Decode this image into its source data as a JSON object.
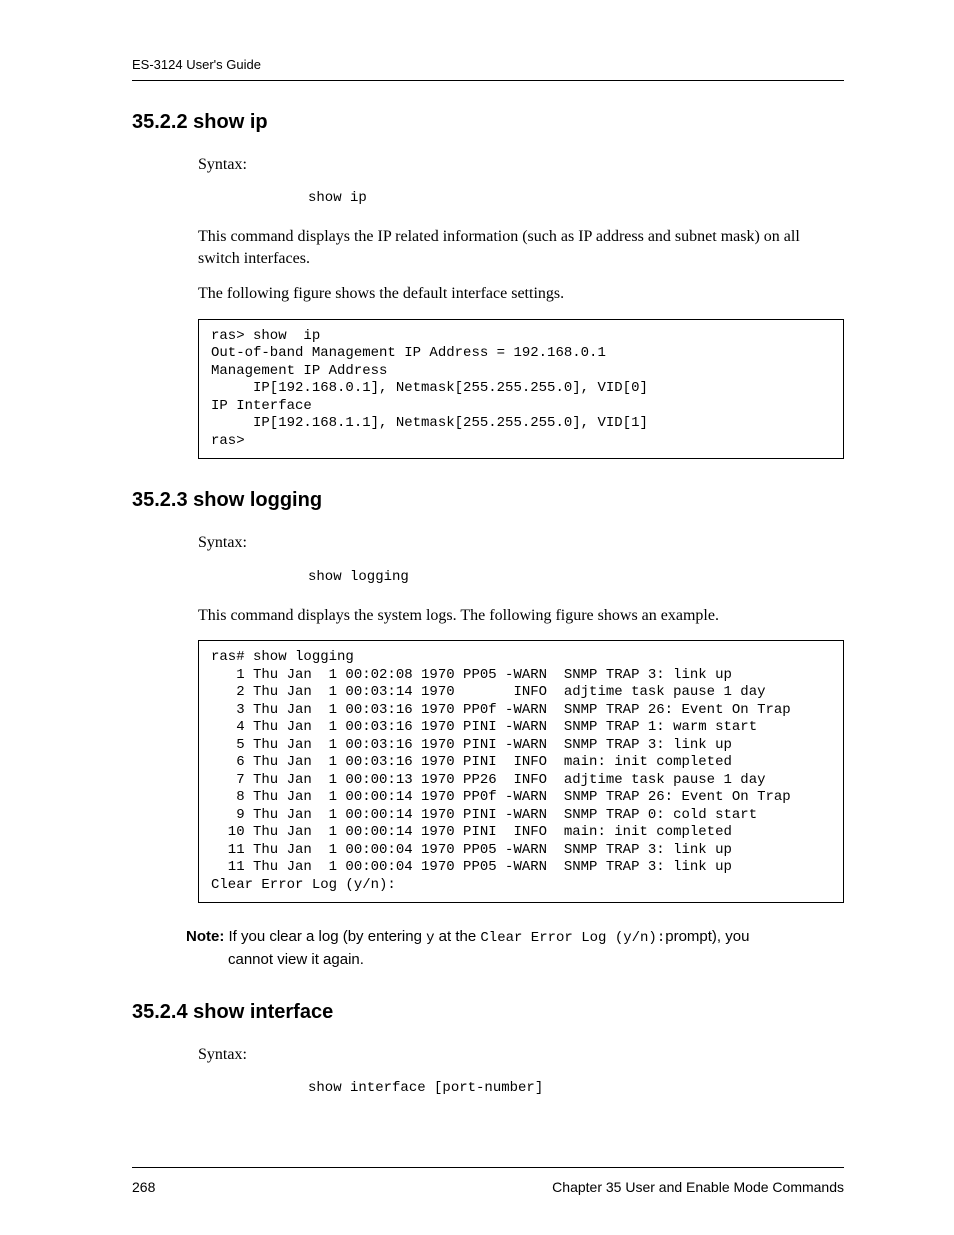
{
  "header": {
    "running_head": "ES-3124 User's Guide"
  },
  "sections": {
    "show_ip": {
      "heading": "35.2.2  show ip",
      "syntax_label": "Syntax:",
      "syntax_cmd": "show ip",
      "para1": "This command displays the IP related information (such as IP address and subnet mask) on all switch interfaces.",
      "para2": "The following figure shows the default interface settings.",
      "code": "ras> show  ip\nOut-of-band Management IP Address = 192.168.0.1\nManagement IP Address\n     IP[192.168.0.1], Netmask[255.255.255.0], VID[0]\nIP Interface\n     IP[192.168.1.1], Netmask[255.255.255.0], VID[1]\nras>"
    },
    "show_logging": {
      "heading": "35.2.3  show logging",
      "syntax_label": "Syntax:",
      "syntax_cmd": "show logging",
      "para1": "This command displays the system logs. The following figure shows an example.",
      "code": "ras# show logging\n   1 Thu Jan  1 00:02:08 1970 PP05 -WARN  SNMP TRAP 3: link up\n   2 Thu Jan  1 00:03:14 1970       INFO  adjtime task pause 1 day\n   3 Thu Jan  1 00:03:16 1970 PP0f -WARN  SNMP TRAP 26: Event On Trap\n   4 Thu Jan  1 00:03:16 1970 PINI -WARN  SNMP TRAP 1: warm start\n   5 Thu Jan  1 00:03:16 1970 PINI -WARN  SNMP TRAP 3: link up\n   6 Thu Jan  1 00:03:16 1970 PINI  INFO  main: init completed\n   7 Thu Jan  1 00:00:13 1970 PP26  INFO  adjtime task pause 1 day\n   8 Thu Jan  1 00:00:14 1970 PP0f -WARN  SNMP TRAP 26: Event On Trap\n   9 Thu Jan  1 00:00:14 1970 PINI -WARN  SNMP TRAP 0: cold start\n  10 Thu Jan  1 00:00:14 1970 PINI  INFO  main: init completed\n  11 Thu Jan  1 00:00:04 1970 PP05 -WARN  SNMP TRAP 3: link up\n  11 Thu Jan  1 00:00:04 1970 PP05 -WARN  SNMP TRAP 3: link up\nClear Error Log (y/n):",
      "note_strong": "Note:",
      "note_text_a": " If you clear a log (by entering ",
      "note_inline_y": "y",
      "note_text_b": " at the ",
      "note_inline_prompt": "Clear Error Log (y/n):",
      "note_text_c": "prompt), you",
      "note_text_d": "cannot view it again."
    },
    "show_interface": {
      "heading": "35.2.4  show interface",
      "syntax_label": "Syntax:",
      "syntax_cmd": "show interface [port-number]"
    }
  },
  "footer": {
    "page_num": "268",
    "chapter": "Chapter 35  User and Enable Mode Commands"
  }
}
